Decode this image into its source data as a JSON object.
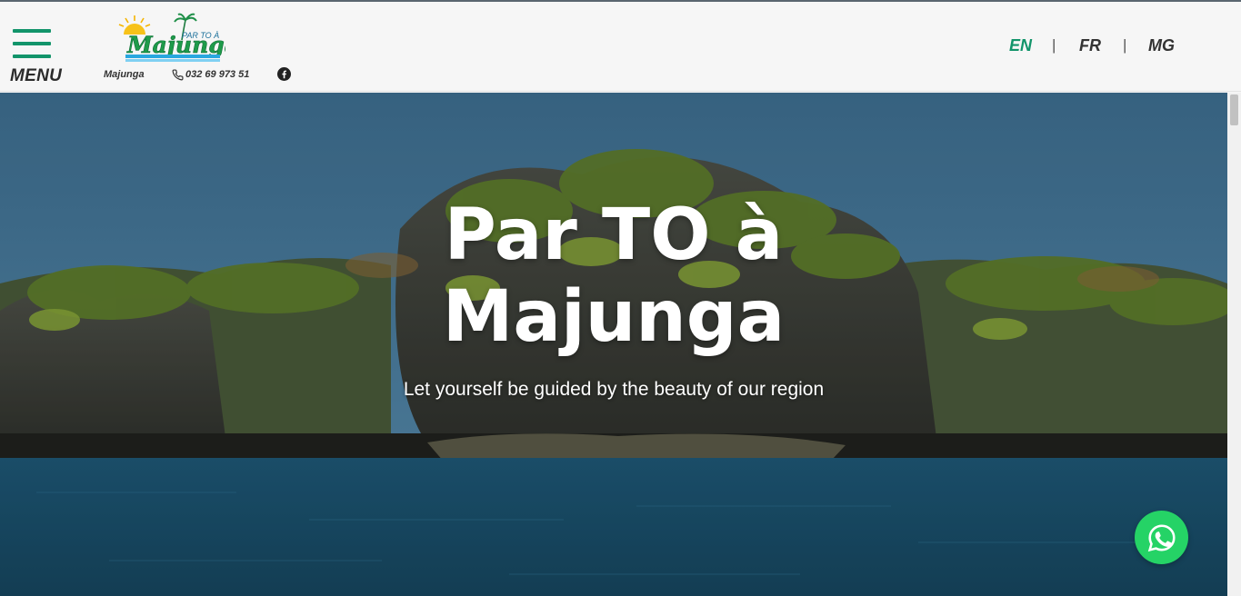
{
  "header": {
    "menu_label": "MENU",
    "logo": {
      "small_text": "PAR TO À",
      "brand_text": "Majunga"
    },
    "city": "Majunga",
    "phone": "032 69 973 51",
    "social_icon": "facebook-icon",
    "languages": [
      {
        "code": "EN",
        "active": true
      },
      {
        "code": "FR",
        "active": false
      },
      {
        "code": "MG",
        "active": false
      }
    ],
    "lang_separator": "|"
  },
  "hero": {
    "title_line1": "Par TO à",
    "title_line2": "Majunga",
    "subtitle": "Let yourself be guided by the beauty of our region"
  },
  "floating": {
    "whatsapp_icon": "whatsapp-icon"
  },
  "colors": {
    "accent": "#12946a",
    "whatsapp": "#25d366",
    "header_bg": "#f6f6f6"
  }
}
